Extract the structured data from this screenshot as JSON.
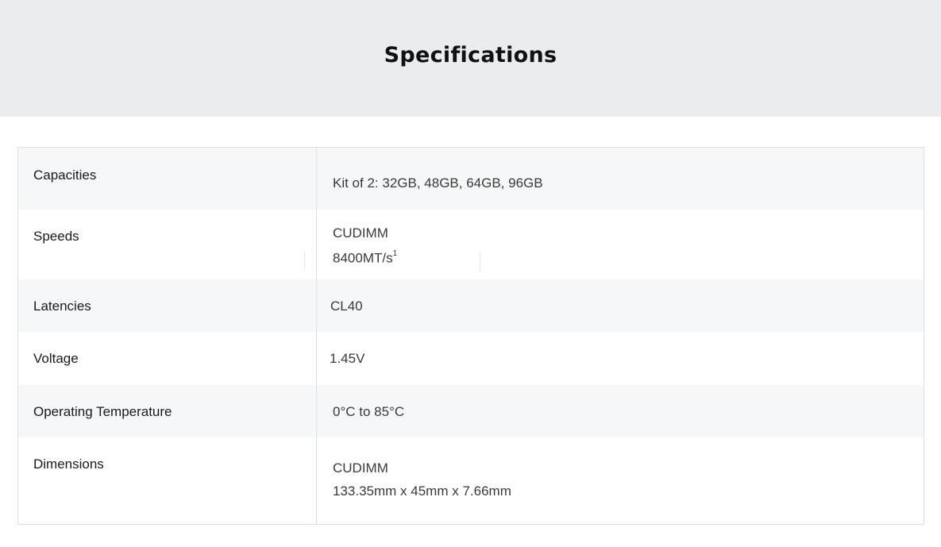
{
  "header": {
    "title": "Specifications"
  },
  "specs": [
    {
      "label": "Capacities",
      "value_lines": [
        "Kit of 2: 32GB, 48GB, 64GB, 96GB"
      ]
    },
    {
      "label": "Speeds",
      "value_line1": "CUDIMM",
      "value_line2": "8400MT/s",
      "footnote": "1"
    },
    {
      "label": "Latencies",
      "value_lines": [
        "CL40"
      ]
    },
    {
      "label": "Voltage",
      "value_lines": [
        "1.45V"
      ]
    },
    {
      "label": "Operating Temperature",
      "value_lines": [
        "0°C to 85°C"
      ]
    },
    {
      "label": "Dimensions",
      "value_lines": [
        "CUDIMM",
        "133.35mm x 45mm x 7.66mm"
      ]
    }
  ]
}
